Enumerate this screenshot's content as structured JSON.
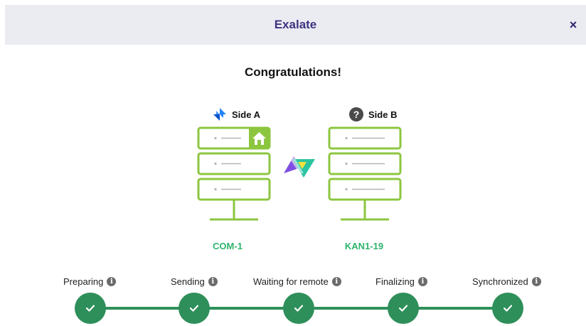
{
  "header": {
    "title": "Exalate",
    "close_label": "×"
  },
  "heading": "Congratulations!",
  "side_a": {
    "label": "Side A",
    "icon": "jira-icon",
    "issue_key": "COM-1"
  },
  "side_b": {
    "label": "Side B",
    "icon": "question-icon",
    "issue_key": "KAN1-19"
  },
  "steps": [
    {
      "label": "Preparing",
      "status": "done"
    },
    {
      "label": "Sending",
      "status": "done"
    },
    {
      "label": "Waiting for remote",
      "status": "done"
    },
    {
      "label": "Finalizing",
      "status": "done"
    },
    {
      "label": "Synchronized",
      "status": "done"
    }
  ],
  "colors": {
    "header_bg": "#ebebf2",
    "title": "#3b3580",
    "server_green": "#8cc63f",
    "issue_key_green": "#2eb36d",
    "progress_green": "#2e8f5a"
  }
}
